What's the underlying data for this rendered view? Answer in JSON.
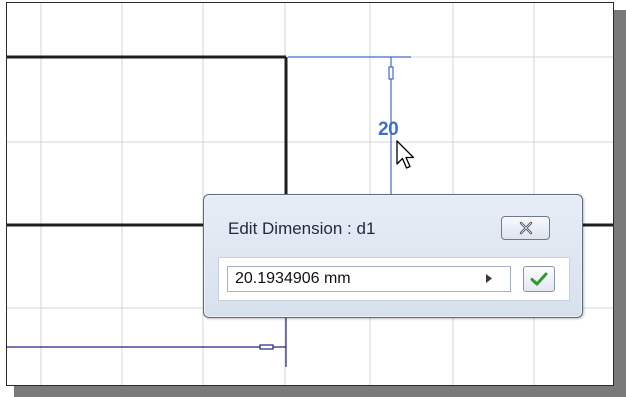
{
  "sketch": {
    "dimension_value": "20"
  },
  "dialog": {
    "title": "Edit Dimension : d1",
    "value": "20.1934906 mm",
    "close_icon": "close-x-icon",
    "accept_icon": "green-checkmark-icon",
    "arrow_icon": "triangle-right-icon"
  },
  "colors": {
    "grid": "#d4d4d4",
    "sketch_line": "#1e1e1e",
    "dimension_line": "#3f6fc6",
    "dimension_line_dark": "#23238a",
    "accept_check": "#2f9a2f"
  }
}
